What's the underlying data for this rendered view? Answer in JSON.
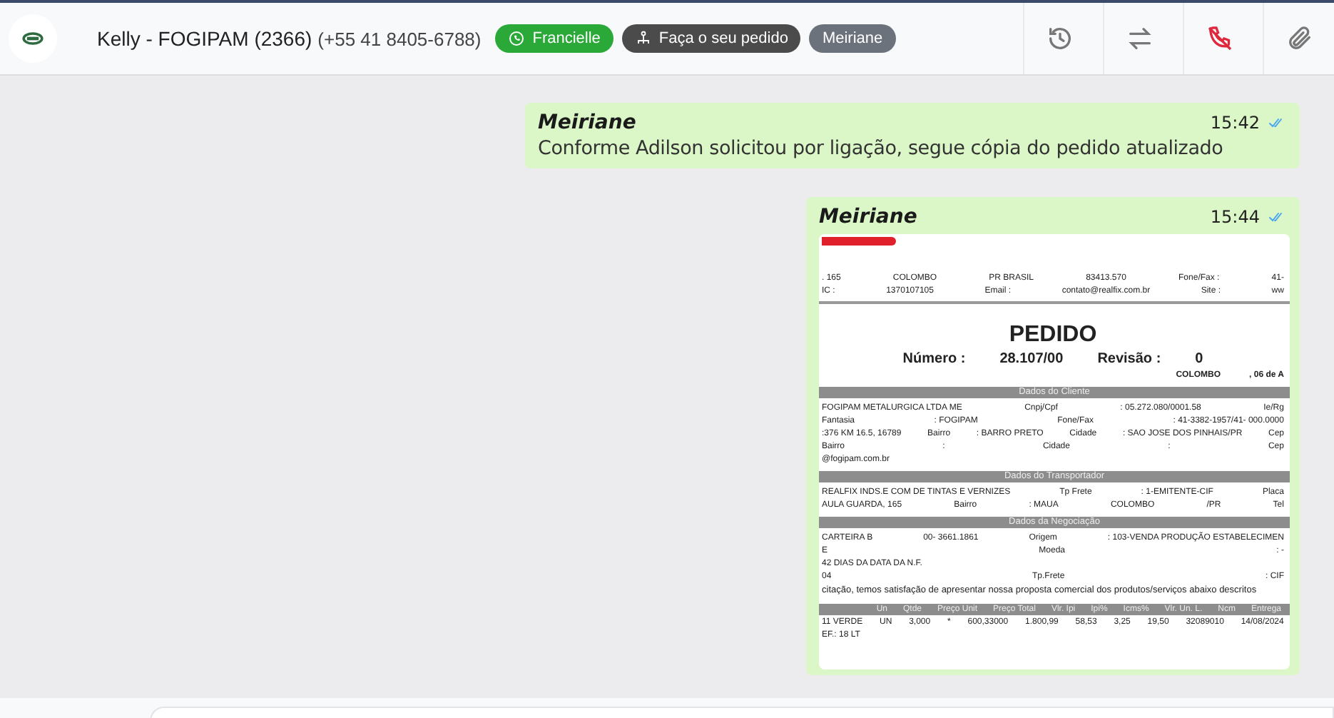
{
  "header": {
    "contact_name": "Kelly - FOGIPAM (2366)",
    "phone": "(+55 41 8405-6788)",
    "chips": [
      {
        "kind": "whatsapp",
        "label": "Francielle"
      },
      {
        "kind": "order",
        "label": "Faça o seu pedido"
      },
      {
        "kind": "agent",
        "label": "Meiriane"
      }
    ],
    "actions": [
      {
        "kind": "history"
      },
      {
        "kind": "transfer"
      },
      {
        "kind": "hangup"
      },
      {
        "kind": "attach"
      }
    ]
  },
  "messages": [
    {
      "kind": "text",
      "sender": "Meiriane",
      "time": "15:42",
      "read": true,
      "text": "Conforme Adilson solicitou por ligação, segue cópia do pedido atualizado"
    },
    {
      "kind": "document",
      "sender": "Meiriane",
      "time": "15:44",
      "read": true,
      "document": {
        "rows": [
          {
            "kind": "logo"
          },
          {
            "kind": "cells",
            "cells": [
              ". 165",
              "COLOMBO",
              "PR   BRASIL",
              "83413.570",
              "Fone/Fax :",
              "41-"
            ]
          },
          {
            "kind": "cells",
            "cells": [
              "IC :",
              "1370107105",
              "Email :",
              "contato@realfix.com.br",
              "Site :",
              "ww"
            ]
          },
          {
            "kind": "rule"
          },
          {
            "kind": "title",
            "cells": [
              "PEDIDO"
            ]
          },
          {
            "kind": "number",
            "cells": [
              "Número :",
              "28.107/00",
              "Revisão :",
              "0"
            ]
          },
          {
            "kind": "date",
            "cells": [
              "COLOMBO",
              ", 06 de A"
            ]
          },
          {
            "kind": "bar",
            "cells": [
              "Dados do Cliente"
            ]
          },
          {
            "kind": "cells",
            "cells": [
              "FOGIPAM METALURGICA LTDA ME",
              "Cnpj/Cpf",
              ": 05.272.080/0001.58",
              "Ie/Rg"
            ]
          },
          {
            "kind": "cells",
            "cells": [
              "Fantasia",
              ": FOGIPAM",
              "Fone/Fax",
              ": 41-3382-1957/41- 000.0000"
            ]
          },
          {
            "kind": "cells",
            "cells": [
              ":376 KM 16.5, 16789",
              "Bairro",
              ": BARRO PRETO",
              "Cidade",
              ": SAO JOSE DOS PINHAIS/PR",
              "Cep"
            ]
          },
          {
            "kind": "cells",
            "cells": [
              "Bairro",
              ":",
              "Cidade",
              ":",
              "Cep"
            ]
          },
          {
            "kind": "cells",
            "cells": [
              "@fogipam.com.br"
            ]
          },
          {
            "kind": "bar",
            "cells": [
              "Dados do Transportador"
            ]
          },
          {
            "kind": "cells",
            "cells": [
              "REALFIX INDS.E COM DE TINTAS E VERNIZES",
              "Tp Frete",
              ": 1-EMITENTE-CIF",
              "Placa"
            ]
          },
          {
            "kind": "cells",
            "cells": [
              "AULA GUARDA, 165",
              "Bairro",
              ": MAUA",
              "COLOMBO",
              "/PR",
              "Tel"
            ]
          },
          {
            "kind": "bar",
            "cells": [
              "Dados da Negociação"
            ]
          },
          {
            "kind": "cells",
            "cells": [
              "CARTEIRA B",
              "00- 3661.1861",
              "Origem",
              ": 103-VENDA PRODUÇÃO ESTABELECIMEN"
            ]
          },
          {
            "kind": "cells",
            "cells": [
              "E",
              "Moeda",
              ": -"
            ]
          },
          {
            "kind": "cells",
            "cells": [
              "42 DIAS DA DATA DA N.F."
            ]
          },
          {
            "kind": "cells",
            "cells": [
              "04",
              "Tp.Frete",
              ": CIF"
            ]
          },
          {
            "kind": "sentence",
            "cells": [
              "citação, temos satisfação de apresentar nossa proposta comercial dos produtos/serviços abaixo descritos"
            ]
          },
          {
            "kind": "header",
            "cells": [
              "Un",
              "Qtde",
              "Preço Unit",
              "Preço Total",
              "Vlr. Ipi",
              "Ipi%",
              "Icms%",
              "Vlr. Un. L.",
              "Ncm",
              "Entrega"
            ]
          },
          {
            "kind": "cells",
            "cells": [
              "11 VERDE",
              "UN",
              "3,000",
              "*",
              "600,33000",
              "1.800,99",
              "58,53",
              "3,25",
              "19,50",
              "32089010",
              "14/08/2024"
            ]
          },
          {
            "kind": "cells",
            "cells": [
              "EF.: 18 LT"
            ]
          }
        ]
      }
    }
  ]
}
